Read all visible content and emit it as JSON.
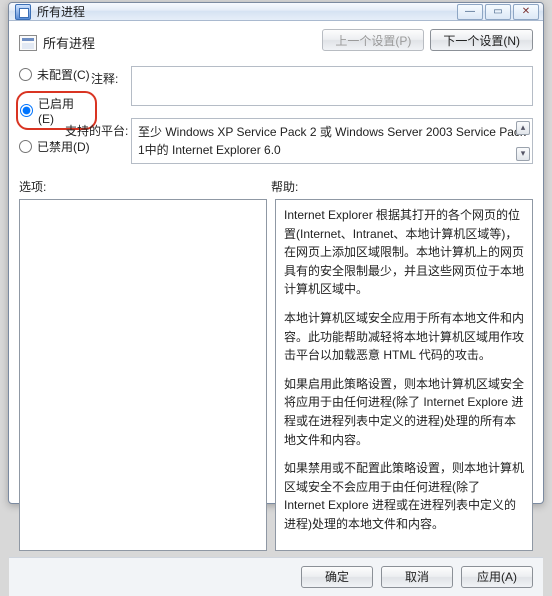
{
  "window": {
    "title": "所有进程",
    "min": "—",
    "max": "▭",
    "close": "✕"
  },
  "heading": "所有进程",
  "nav": {
    "prev": "上一个设置(P)",
    "next": "下一个设置(N)"
  },
  "radios": {
    "unconfigured": "未配置(C)",
    "enabled": "已启用(E)",
    "disabled": "已禁用(D)",
    "selected": "enabled"
  },
  "fields": {
    "note_label": "注释:",
    "note_value": "",
    "platform_label": "支持的平台:",
    "platform_value": "至少 Windows XP Service Pack 2 或 Windows Server 2003 Service Pack 1中的 Internet Explorer 6.0"
  },
  "labels": {
    "options": "选项:",
    "help": "帮助:"
  },
  "help_paragraphs": [
    "Internet Explorer 根据其打开的各个网页的位置(Internet、Intranet、本地计算机区域等)，在网页上添加区域限制。本地计算机上的网页具有的安全限制最少，并且这些网页位于本地计算机区域中。",
    "本地计算机区域安全应用于所有本地文件和内容。此功能帮助减轻将本地计算机区域用作攻击平台以加载恶意 HTML 代码的攻击。",
    "如果启用此策略设置，则本地计算机区域安全将应用于由任何进程(除了 Internet Explore 进程或在进程列表中定义的进程)处理的所有本地文件和内容。",
    "如果禁用或不配置此策略设置，则本地计算机区域安全不会应用于由任何进程(除了 Internet Explore 进程或在进程列表中定义的进程)处理的本地文件和内容。"
  ],
  "footer": {
    "ok": "确定",
    "cancel": "取消",
    "apply": "应用(A)"
  }
}
